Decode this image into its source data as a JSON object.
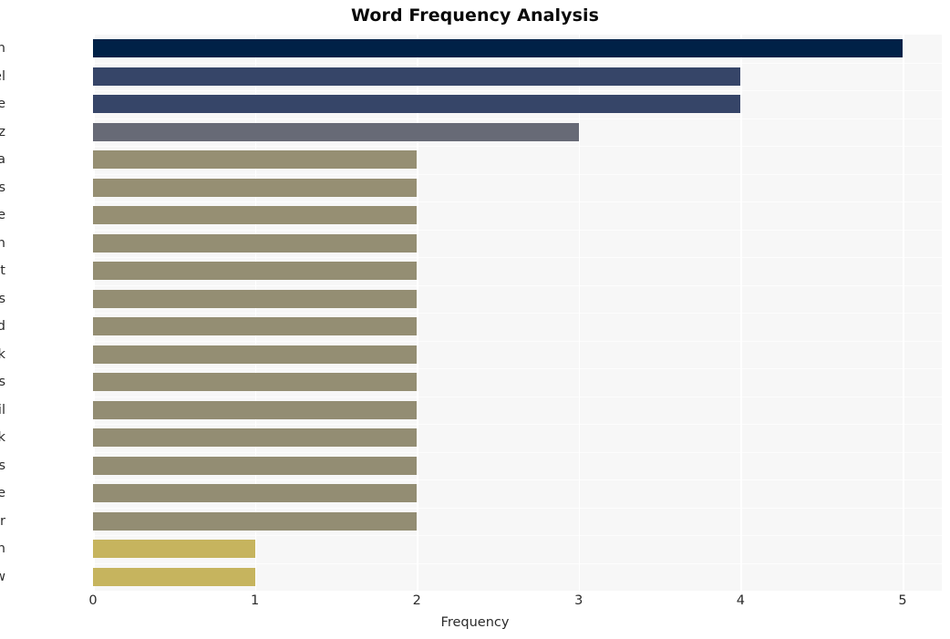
{
  "chart_data": {
    "type": "bar",
    "orientation": "horizontal",
    "title": "Word Frequency Analysis",
    "xlabel": "Frequency",
    "ylabel": "",
    "categories": [
      "sign",
      "israel",
      "vote",
      "walz",
      "kamala",
      "harris",
      "take",
      "palestinian",
      "movement",
      "business",
      "read",
      "thank",
      "preferences",
      "email",
      "click",
      "democrats",
      "house",
      "insider",
      "hash",
      "new"
    ],
    "values": [
      5,
      4,
      4,
      3,
      2,
      2,
      2,
      2,
      2,
      2,
      2,
      2,
      2,
      2,
      2,
      2,
      2,
      2,
      1,
      1
    ],
    "bar_colors": [
      "#002147",
      "#364568",
      "#364568",
      "#676a76",
      "#968f73",
      "#968f73",
      "#968f73",
      "#948e73",
      "#948e73",
      "#948e73",
      "#948e73",
      "#948e73",
      "#948e73",
      "#938d73",
      "#938d73",
      "#938d73",
      "#938d73",
      "#938d73",
      "#c6b45e",
      "#c6b45e"
    ],
    "xlim": [
      0,
      5
    ],
    "xticks": [
      0,
      1,
      2,
      3,
      4,
      5
    ],
    "xticklabels": [
      "0",
      "1",
      "2",
      "3",
      "4",
      "5"
    ],
    "grid": true,
    "grid_color": "#ffffff",
    "plot_background": "#f7f7f7",
    "figure_background": "#ffffff",
    "legend": null
  }
}
